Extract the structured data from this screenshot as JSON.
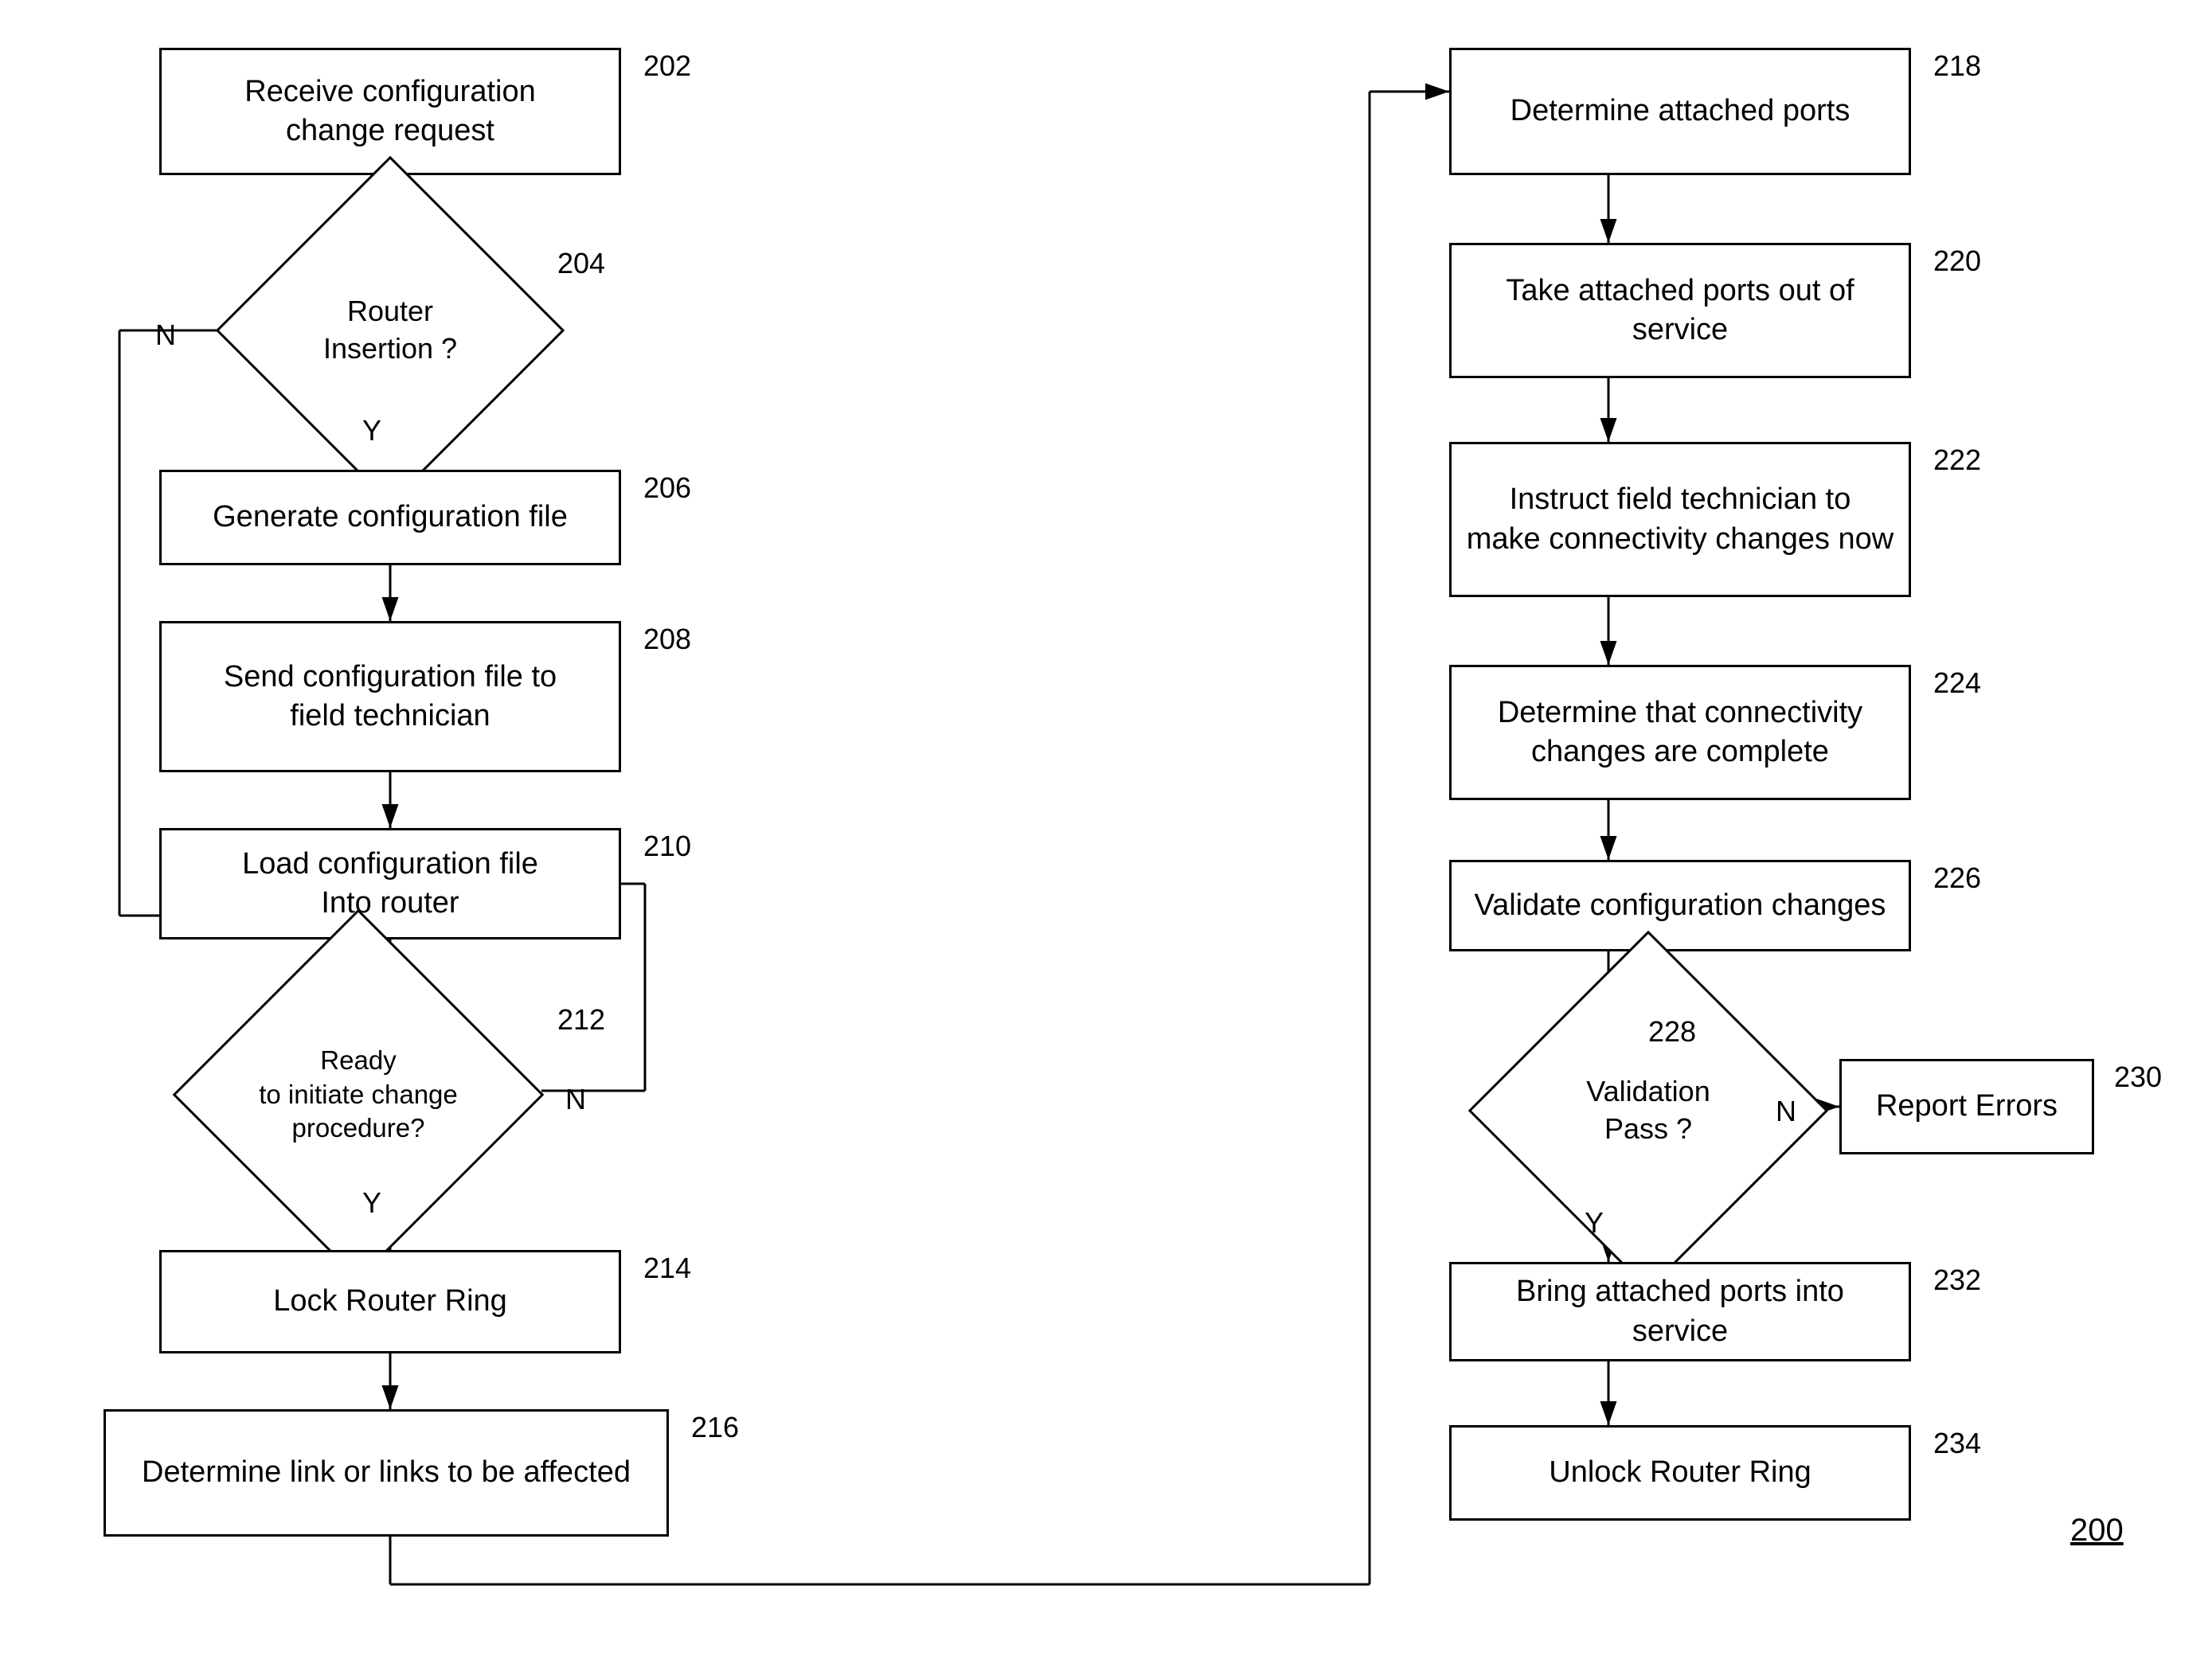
{
  "diagram": {
    "label": "200",
    "nodes": {
      "n202": {
        "label": "Receive configuration\nchange request",
        "num": "202"
      },
      "n204": {
        "label": "Router\nInsertion ?",
        "num": "204"
      },
      "n206": {
        "label": "Generate configuration file",
        "num": "206"
      },
      "n208": {
        "label": "Send configuration file to\nfield technician",
        "num": "208"
      },
      "n210": {
        "label": "Load configuration file\nInto router",
        "num": "210"
      },
      "n212": {
        "label": "Ready\nto initiate change\nprocedure?",
        "num": "212"
      },
      "n214": {
        "label": "Lock Router Ring",
        "num": "214"
      },
      "n216": {
        "label": "Determine link or links to be affected",
        "num": "216"
      },
      "n218": {
        "label": "Determine attached ports",
        "num": "218"
      },
      "n220": {
        "label": "Take attached ports out of service",
        "num": "220"
      },
      "n222": {
        "label": "Instruct field technician to\nmake connectivity changes now",
        "num": "222"
      },
      "n224": {
        "label": "Determine that connectivity\nchanges are complete",
        "num": "224"
      },
      "n226": {
        "label": "Validate configuration changes",
        "num": "226"
      },
      "n228": {
        "label": "Validation\nPass ?",
        "num": "228"
      },
      "n230": {
        "label": "Report Errors",
        "num": "230"
      },
      "n232": {
        "label": "Bring attached ports into service",
        "num": "232"
      },
      "n234": {
        "label": "Unlock Router Ring",
        "num": "234"
      }
    },
    "labels": {
      "n_label": "N",
      "y_label": "Y",
      "n_label2": "N",
      "y_label2": "Y"
    }
  }
}
